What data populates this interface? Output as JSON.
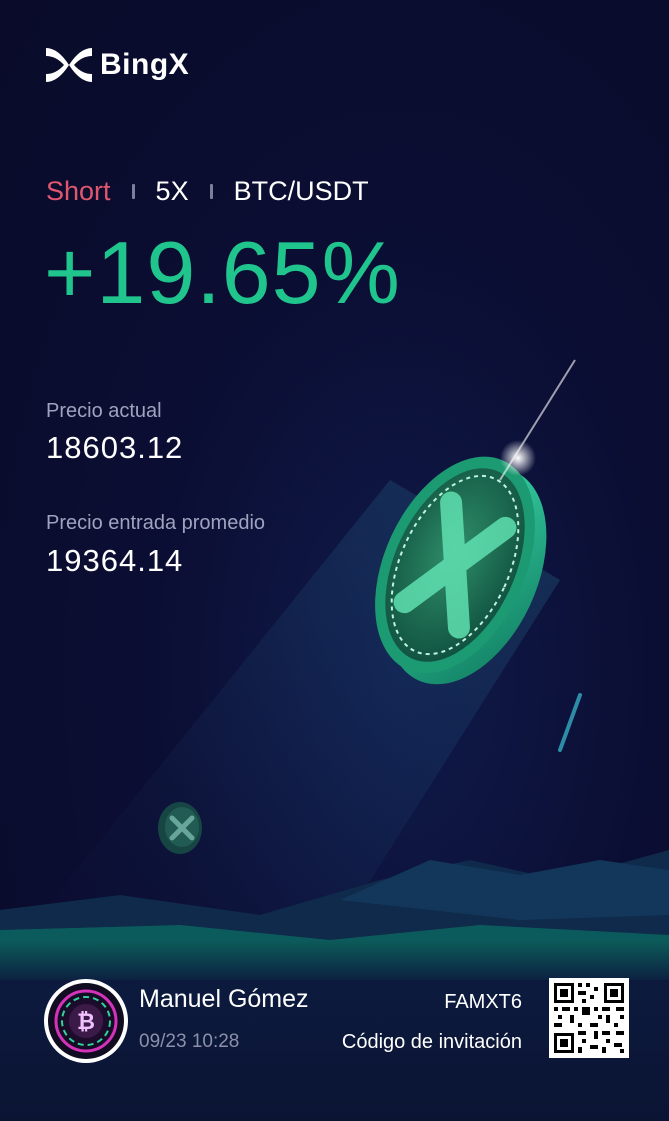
{
  "brand": {
    "name": "BingX",
    "logo_icon": "bingx-x-logo-icon"
  },
  "position": {
    "side": "Short",
    "leverage": "5X",
    "pair": "BTC/USDT",
    "pnl_percent": "+19.65%"
  },
  "prices": {
    "current_label": "Precio actual",
    "current_value": "18603.12",
    "entry_label": "Precio entrada promedio",
    "entry_value": "19364.14"
  },
  "user": {
    "name": "Manuel Gómez",
    "timestamp": "09/23 10:28",
    "avatar_icon": "bitcoin-avatar-icon"
  },
  "invite": {
    "code": "FAMXT6",
    "label": "Código de invitación",
    "qr_icon": "qr-code-icon"
  },
  "colors": {
    "background": "#0b0d2e",
    "short_red": "#e0566f",
    "pnl_green": "#20c58e",
    "muted_text": "#9fa3bf"
  }
}
